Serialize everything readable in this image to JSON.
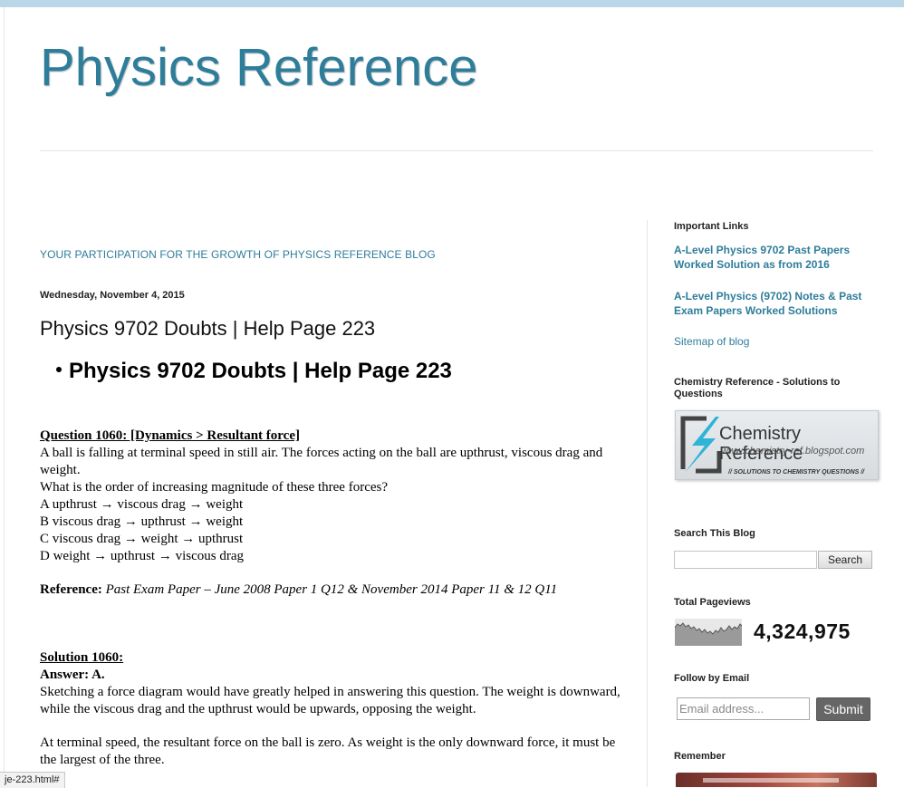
{
  "blog": {
    "title": "Physics Reference",
    "participation_link": "YOUR PARTICIPATION FOR THE GROWTH OF PHYSICS REFERENCE BLOG"
  },
  "post": {
    "date": "Wednesday, November 4, 2015",
    "title": "Physics 9702 Doubts | Help Page 223",
    "heading": "Physics 9702 Doubts | Help Page 223",
    "question_label": "Question 1060: [Dynamics > Resultant force]",
    "question_lines": [
      "A ball is falling at terminal speed in still air. The forces acting on the ball are upthrust, viscous drag and weight.",
      "What is the order of increasing magnitude of these three forces?",
      "A upthrust → viscous drag → weight",
      "B viscous drag → upthrust → weight",
      "C viscous drag → weight → upthrust",
      "D weight → upthrust → viscous drag"
    ],
    "reference_label": "Reference:",
    "reference_text": "Past Exam Paper – June 2008 Paper 1 Q12 & November 2014 Paper 11 & 12 Q11",
    "solution_label": "Solution 1060:",
    "answer_label": "Answer: A.",
    "solution_p1": "Sketching a force diagram would have greatly helped in answering this question. The weight is downward, while the viscous drag and the upthrust would be upwards, opposing the weight.",
    "solution_p2": "At terminal speed, the resultant force on the ball is zero. As weight is the only downward force, it must be the largest of the three."
  },
  "sidebar": {
    "important_links": {
      "heading": "Important Links",
      "links": [
        "A-Level Physics 9702 Past Papers Worked Solution as from 2016",
        "A-Level Physics (9702) Notes & Past Exam Papers Worked Solutions",
        "Sitemap of blog"
      ]
    },
    "chemistry": {
      "heading": "Chemistry Reference - Solutions to Questions",
      "banner_title": "Chemistry Reference",
      "banner_url": "www.chemistry-ref.blogspot.com",
      "banner_tagline": "// SOLUTIONS TO CHEMISTRY QUESTIONS //"
    },
    "search": {
      "heading": "Search This Blog",
      "button_label": "Search"
    },
    "pageviews": {
      "heading": "Total Pageviews",
      "count": "4,324,975"
    },
    "follow": {
      "heading": "Follow by Email",
      "placeholder": "Email address...",
      "button_label": "Submit"
    },
    "remember": {
      "heading": "Remember"
    }
  },
  "status_bar": {
    "url": "je-223.html#"
  },
  "colors": {
    "title_blue": "#2e7d9a",
    "link_blue": "#2e7d9a",
    "top_bar": "#b9d7e6",
    "submit_bg": "#666666"
  }
}
